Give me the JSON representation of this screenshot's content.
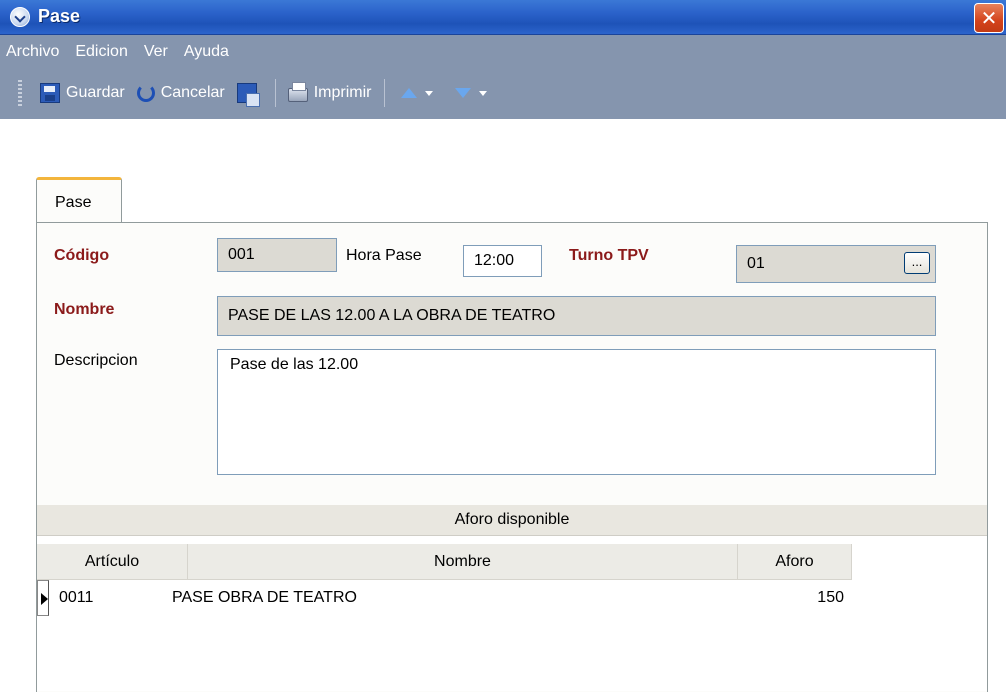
{
  "window": {
    "title": "Pase",
    "close_glyph": "✕"
  },
  "menu": {
    "items": [
      "Archivo",
      "Edicion",
      "Ver",
      "Ayuda"
    ]
  },
  "toolbar": {
    "save_label": "Guardar",
    "cancel_label": "Cancelar",
    "print_label": "Imprimir"
  },
  "tab": {
    "label": "Pase"
  },
  "form": {
    "codigo_label": "Código",
    "codigo_value": "001",
    "hora_label": "Hora Pase",
    "hora_value": "12:00",
    "turno_label": "Turno TPV",
    "turno_value": "01",
    "turno_button": "...",
    "nombre_label": "Nombre",
    "nombre_value": "PASE DE LAS 12.00 A LA OBRA DE TEATRO",
    "descripcion_label": "Descripcion",
    "descripcion_value": "Pase de las 12.00"
  },
  "grid": {
    "title": "Aforo disponible",
    "columns": [
      "Artículo",
      "Nombre",
      "Aforo"
    ],
    "rows": [
      {
        "articulo": "0011",
        "nombre": "PASE OBRA DE TEATRO",
        "aforo": "150"
      }
    ]
  },
  "colors": {
    "titlebar": "#2a61c9",
    "menubar": "#8595ae",
    "required_label": "#8b1a1a",
    "tab_accent": "#f3b53c"
  }
}
